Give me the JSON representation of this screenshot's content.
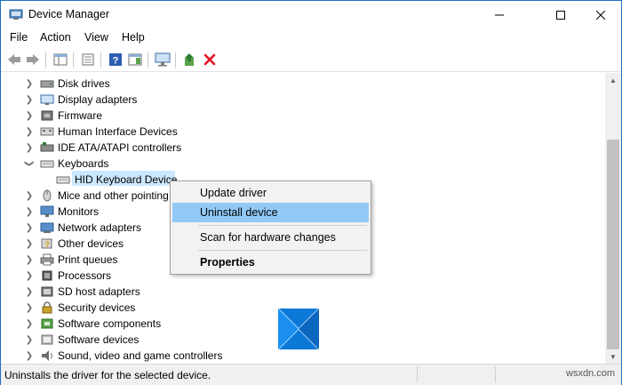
{
  "window": {
    "title": "Device Manager"
  },
  "menu": {
    "items": [
      "File",
      "Action",
      "View",
      "Help"
    ]
  },
  "tree": {
    "items": [
      {
        "label": "Disk drives",
        "icon": "disk-drive-icon",
        "expanded": false
      },
      {
        "label": "Display adapters",
        "icon": "display-adapter-icon",
        "expanded": false
      },
      {
        "label": "Firmware",
        "icon": "firmware-icon",
        "expanded": false
      },
      {
        "label": "Human Interface Devices",
        "icon": "hid-icon",
        "expanded": false
      },
      {
        "label": "IDE ATA/ATAPI controllers",
        "icon": "ide-controller-icon",
        "expanded": false
      },
      {
        "label": "Keyboards",
        "icon": "keyboard-icon",
        "expanded": true
      },
      {
        "label": "HID Keyboard Device",
        "icon": "keyboard-icon",
        "child": true,
        "selected": true
      },
      {
        "label": "Mice and other pointing devices",
        "icon": "mouse-icon",
        "expanded": false
      },
      {
        "label": "Monitors",
        "icon": "monitor-icon",
        "expanded": false
      },
      {
        "label": "Network adapters",
        "icon": "network-adapter-icon",
        "expanded": false
      },
      {
        "label": "Other devices",
        "icon": "other-devices-icon",
        "expanded": false
      },
      {
        "label": "Print queues",
        "icon": "printer-icon",
        "expanded": false
      },
      {
        "label": "Processors",
        "icon": "processor-icon",
        "expanded": false
      },
      {
        "label": "SD host adapters",
        "icon": "sd-host-icon",
        "expanded": false
      },
      {
        "label": "Security devices",
        "icon": "security-device-icon",
        "expanded": false
      },
      {
        "label": "Software components",
        "icon": "software-component-icon",
        "expanded": false
      },
      {
        "label": "Software devices",
        "icon": "software-device-icon",
        "expanded": false
      },
      {
        "label": "Sound, video and game controllers",
        "icon": "sound-icon",
        "expanded": false
      }
    ]
  },
  "context_menu": {
    "items": [
      {
        "label": "Update driver",
        "highlighted": false,
        "bold": false
      },
      {
        "label": "Uninstall device",
        "highlighted": true,
        "bold": false
      },
      {
        "label": "Scan for hardware changes",
        "highlighted": false,
        "bold": false
      },
      {
        "label": "Properties",
        "highlighted": false,
        "bold": true
      }
    ]
  },
  "status": {
    "text": "Uninstalls the driver for the selected device."
  },
  "watermark": {
    "text": "wsxdn.com"
  },
  "colors": {
    "selection": "#cce8ff",
    "menu_highlight": "#91c9f7",
    "delete_red": "#e81123",
    "window_border": "#1e6fc6"
  }
}
